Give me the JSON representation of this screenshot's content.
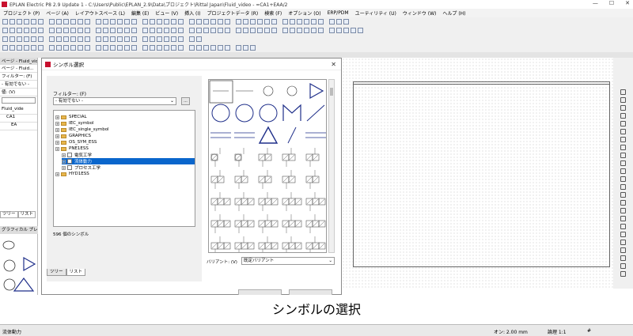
{
  "titlebar": {
    "title": "EPLAN Electric P8 2.9 Update 1 - C:\\Users\\Public\\EPLAN_2.9\\Data\\プロジェクト\\Rittal Japan\\Fluid_video - =CA1+EAA/2",
    "controls": [
      "—",
      "☐",
      "✕"
    ]
  },
  "menu": [
    "プロジェクト (P)",
    "ページ (A)",
    "レイアウトスペース (L)",
    "編集 (E)",
    "ビュー (V)",
    "挿入 (I)",
    "プロジェクトデータ (R)",
    "検索 (F)",
    "オプション (O)",
    "ERP/PDM",
    "ユーティリティ (U)",
    "ウィンドウ (W)",
    "ヘルプ (H)"
  ],
  "left_panel": {
    "title": "ページ - Fluid_vide",
    "subtitle": "ページ - Fluid...",
    "filter_label": "フィルター: (F)",
    "filter_value": "- 有効でない -",
    "value_label": "値: (V)",
    "tree_items": [
      "Fluid_vide",
      "CA1",
      "EA"
    ],
    "tabs": [
      "ツリー",
      "リスト"
    ],
    "preview_title": "グラフィカル プレビュ"
  },
  "dialog": {
    "title": "シンボル選択",
    "close": "✕",
    "filter_label": "フィルター: (F)",
    "filter_value": "- 有効でない -",
    "filter_button": "...",
    "tree": [
      {
        "label": "SPECIAL",
        "type": "folder",
        "level": 0,
        "selected": false
      },
      {
        "label": "IEC_symbol",
        "type": "folder",
        "level": 0,
        "selected": false
      },
      {
        "label": "IEC_single_symbol",
        "type": "folder",
        "level": 0,
        "selected": false
      },
      {
        "label": "GRAPHICS",
        "type": "folder",
        "level": 0,
        "selected": false
      },
      {
        "label": "OS_SYM_ESS",
        "type": "folder",
        "level": 0,
        "selected": false
      },
      {
        "label": "PNE1ESS",
        "type": "folder",
        "level": 0,
        "selected": false
      },
      {
        "label": "電気工学",
        "type": "group",
        "level": 1,
        "selected": false
      },
      {
        "label": "流体動力",
        "type": "group",
        "level": 1,
        "selected": true
      },
      {
        "label": "プロセス工学",
        "type": "group",
        "level": 1,
        "selected": false
      },
      {
        "label": "HYD1ESS",
        "type": "folder",
        "level": 0,
        "selected": false
      }
    ],
    "count": "596 個のシンボル",
    "tabs": [
      "ツリー",
      "リスト"
    ],
    "variant_label": "バリアント: (V)",
    "variant_value": "既定バリアント"
  },
  "caption": "シンボルの選択",
  "statusbar": {
    "left": "流体動力",
    "grid": "オン: 2.00 mm",
    "scale": "論理 1:1",
    "hash": "#"
  },
  "colors": {
    "selection": "#0a66cc",
    "symbol_stroke": "#1f2f8a",
    "app_icon": "#c8102e"
  }
}
